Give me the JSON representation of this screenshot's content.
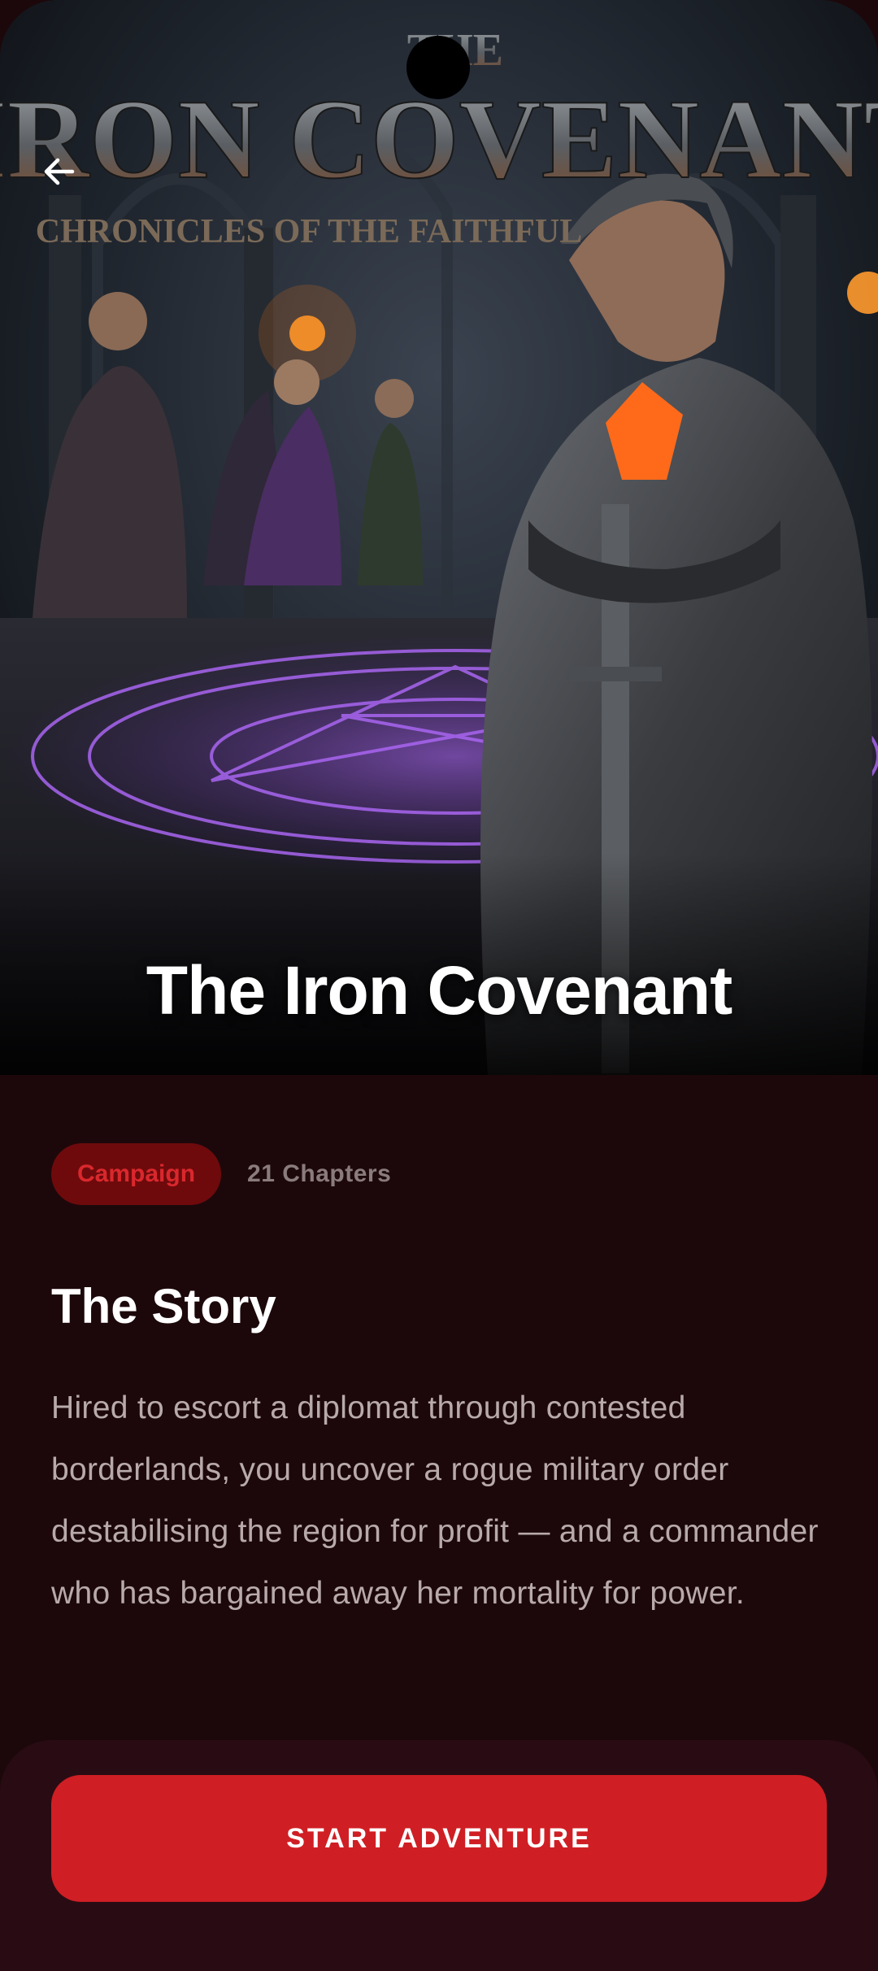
{
  "hero": {
    "art_title_lines": [
      "THE",
      "IRON COVENANT"
    ],
    "art_subtitle": "CHRONICLES OF THE FAITHFUL",
    "title": "The Iron Covenant"
  },
  "header": {
    "back_icon": "arrow-left-icon"
  },
  "meta": {
    "badge": "Campaign",
    "chapters": "21 Chapters"
  },
  "story": {
    "heading": "The Story",
    "body": "Hired to escort a diplomat through contested borderlands, you uncover a rogue military order destabilising the region for profit — and a commander who has bargained away her mortality for power."
  },
  "action": {
    "start_label": "START ADVENTURE"
  },
  "colors": {
    "accent": "#cf1f24",
    "badge_bg": "#6e0a0c",
    "background": "#1c080b",
    "panel": "#290c13"
  }
}
